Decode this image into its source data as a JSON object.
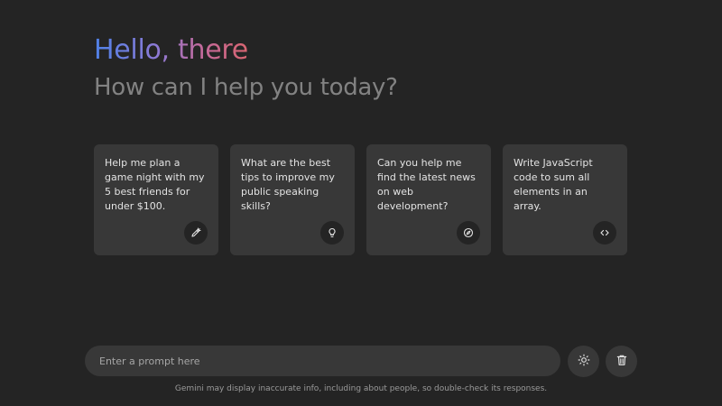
{
  "header": {
    "greeting": "Hello, there",
    "subtitle": "How can I help you today?"
  },
  "cards": [
    {
      "text": "Help me plan a game night with my 5 best friends for under $100.",
      "icon": "pencil-icon"
    },
    {
      "text": "What are the best tips to improve my public speaking skills?",
      "icon": "lightbulb-icon"
    },
    {
      "text": "Can you help me find the latest news on web development?",
      "icon": "compass-icon"
    },
    {
      "text": "Write JavaScript code to sum all elements in an array.",
      "icon": "code-icon"
    }
  ],
  "prompt": {
    "placeholder": "Enter a prompt here",
    "value": ""
  },
  "actions": {
    "theme_icon": "sun-icon",
    "delete_icon": "trash-icon"
  },
  "footer": {
    "disclaimer": "Gemini may display inaccurate info, including about people, so double-check its responses."
  },
  "colors": {
    "background": "#242424",
    "surface": "#383838",
    "text": "#e3e3e3",
    "subtitle": "#828282",
    "gradient_start": "#4f81e6",
    "gradient_end": "#d96570"
  }
}
